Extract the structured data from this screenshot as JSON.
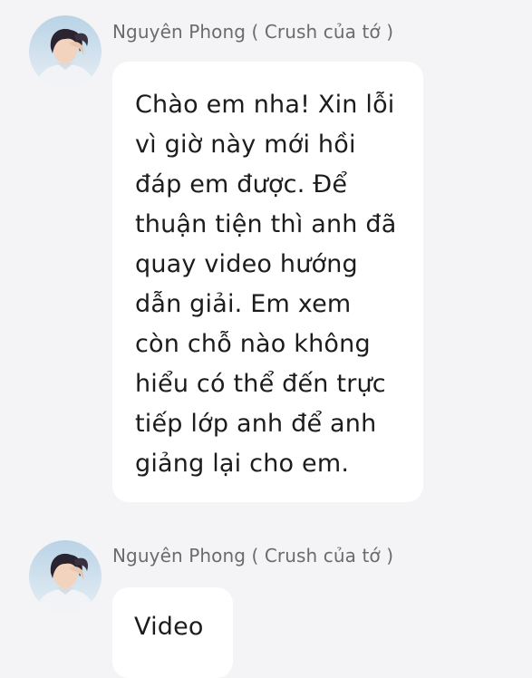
{
  "messages": [
    {
      "sender": "Nguyên Phong ( Crush của tớ )",
      "avatar_icon": "user-avatar",
      "text": "Chào em nha!  Xin lỗi vì giờ này mới hồi đáp em được. Để thuận tiện thì anh đã quay video hướng dẫn giải. Em xem còn chỗ nào không hiểu có thể đến trực tiếp lớp anh để anh giảng lại cho em."
    },
    {
      "sender": "Nguyên Phong ( Crush của tớ )",
      "avatar_icon": "user-avatar",
      "text": "Video"
    }
  ],
  "colors": {
    "background": "#f4f4f6",
    "bubble": "#ffffff",
    "sender_text": "#6b6b6b",
    "message_text": "#1c1c1c"
  }
}
